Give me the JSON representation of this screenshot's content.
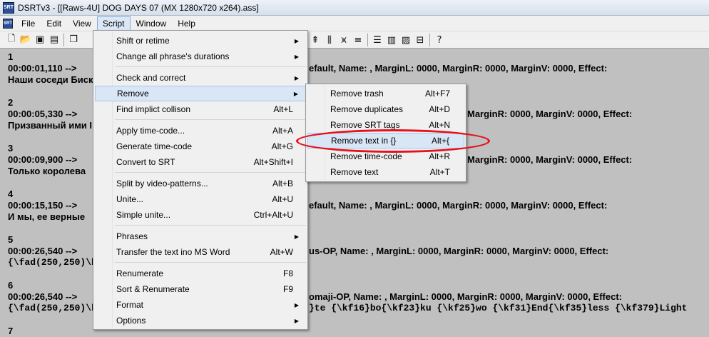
{
  "window": {
    "title": "DSRTv3 - [[Raws-4U] DOG DAYS 07 (MX 1280x720 x264).ass]",
    "icon_text": "SRT"
  },
  "menubar": [
    "File",
    "Edit",
    "View",
    "Script",
    "Window",
    "Help"
  ],
  "toolbar": {
    "left_icons": [
      "new-file-icon",
      "open-folder-icon",
      "save-icon",
      "save-all-icon",
      "copy-icon"
    ],
    "right_icons": [
      "align-icon",
      "bounds-icon",
      "split-icon",
      "list-icon",
      "list-alt-icon",
      "lines-icon",
      "image-icon",
      "stamp-icon",
      "help-icon"
    ]
  },
  "content": {
    "entries": [
      {
        "num": "1",
        "time": "00:00:01,110 -->",
        "text": "Наши соседи Биск",
        "right": "efault, Name: , MarginL: 0000, MarginR: 0000, MarginV: 0000, Effect:"
      },
      {
        "num": "2",
        "time": "00:00:05,330 -->",
        "text": "Призванный ими I",
        "right": "MarginR: 0000, MarginV: 0000, Effect:"
      },
      {
        "num": "3",
        "time": "00:00:09,900 -->",
        "text": "Только королева",
        "right": "MarginR: 0000, MarginV: 0000, Effect:"
      },
      {
        "num": "4",
        "time": "00:00:15,150 -->",
        "text": "И мы, ее верные",
        "right": "efault, Name: , MarginL: 0000, MarginR: 0000, MarginV: 0000, Effect:"
      },
      {
        "num": "5",
        "time": "00:00:26,540 -->",
        "text": "{\\fad(250,250)\\b",
        "right": "us-OP, Name: , MarginL: 0000, MarginR: 0000, MarginV: 0000, Effect:"
      },
      {
        "num": "6",
        "time": "00:00:26,540 -->",
        "text": "{\\fad(250,250)\\k",
        "right": "omaji-OP, Name: , MarginL: 0000, MarginR: 0000, MarginV: 0000, Effect:",
        "right2": "}te {\\kf16}bo{\\kf23}ku {\\kf25}wo {\\kf31}End{\\kf35}less {\\kf379}Light"
      },
      {
        "num": "7"
      }
    ]
  },
  "script_menu": {
    "items": [
      {
        "label": "Shift or retime",
        "shortcut": "",
        "submenu": true
      },
      {
        "label": "Change all phrase's durations",
        "shortcut": "",
        "submenu": true
      },
      {
        "label": "Check and correct",
        "shortcut": "",
        "submenu": true
      },
      {
        "label": "Remove",
        "shortcut": "",
        "submenu": true
      },
      {
        "label": "Find implict collison",
        "shortcut": "Alt+L",
        "submenu": false
      },
      {
        "label": "Apply time-code...",
        "shortcut": "Alt+A",
        "submenu": false
      },
      {
        "label": "Generate time-code",
        "shortcut": "Alt+G",
        "submenu": false
      },
      {
        "label": "Convert to SRT",
        "shortcut": "Alt+Shift+I",
        "submenu": false
      },
      {
        "label": "Split by video-patterns...",
        "shortcut": "Alt+B",
        "submenu": false
      },
      {
        "label": "Unite...",
        "shortcut": "Alt+U",
        "submenu": false
      },
      {
        "label": "Simple unite...",
        "shortcut": "Ctrl+Alt+U",
        "submenu": false
      },
      {
        "label": "Phrases",
        "shortcut": "",
        "submenu": true
      },
      {
        "label": "Transfer the text ino MS Word",
        "shortcut": "Alt+W",
        "submenu": false
      },
      {
        "label": "Renumerate",
        "shortcut": "F8",
        "submenu": false
      },
      {
        "label": "Sort & Renumerate",
        "shortcut": "F9",
        "submenu": false
      },
      {
        "label": "Format",
        "shortcut": "",
        "submenu": true
      },
      {
        "label": "Options",
        "shortcut": "",
        "submenu": true
      }
    ]
  },
  "remove_submenu": {
    "items": [
      {
        "label": "Remove trash",
        "shortcut": "Alt+F7"
      },
      {
        "label": "Remove duplicates",
        "shortcut": "Alt+D"
      },
      {
        "label": "Remove SRT tags",
        "shortcut": "Alt+N"
      },
      {
        "label": "Remove text in {}",
        "shortcut": "Alt+{"
      },
      {
        "label": "Remove time-code",
        "shortcut": "Alt+R"
      },
      {
        "label": "Remove text",
        "shortcut": "Alt+T"
      }
    ]
  },
  "colors": {
    "highlight": "#d8e6f6",
    "annotation": "#e8101a",
    "background": "#c0c0c0"
  }
}
